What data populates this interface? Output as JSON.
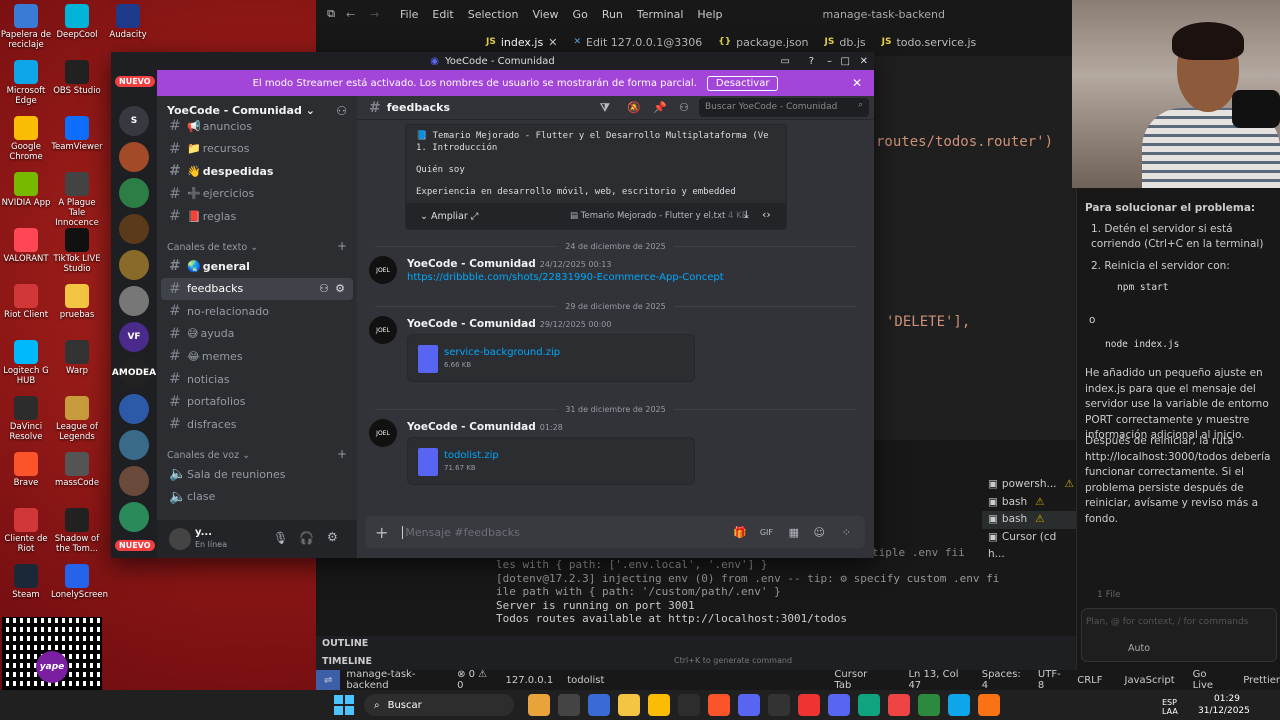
{
  "desktop": {
    "icons": [
      {
        "label": "Papelera de reciclaje",
        "icon": "recycle-bin-icon"
      },
      {
        "label": "DeepCool",
        "icon": "deepcool-icon"
      },
      {
        "label": "Audacity",
        "icon": "audacity-icon"
      },
      {
        "label": "Microsoft Edge",
        "icon": "edge-icon"
      },
      {
        "label": "OBS Studio",
        "icon": "obs-icon"
      },
      {
        "label": "Google Chrome",
        "icon": "chrome-icon"
      },
      {
        "label": "TeamViewer",
        "icon": "teamviewer-icon"
      },
      {
        "label": "NVIDIA App",
        "icon": "nvidia-icon"
      },
      {
        "label": "A Plague Tale Innocence",
        "icon": "game-icon"
      },
      {
        "label": "VALORANT",
        "icon": "valorant-icon"
      },
      {
        "label": "TikTok LIVE Studio",
        "icon": "tiktok-icon"
      },
      {
        "label": "Riot Client",
        "icon": "riot-icon"
      },
      {
        "label": "pruebas",
        "icon": "folder-icon"
      },
      {
        "label": "Logitech G HUB",
        "icon": "logitech-icon"
      },
      {
        "label": "Warp",
        "icon": "warp-icon"
      },
      {
        "label": "DaVinci Resolve",
        "icon": "davinci-icon"
      },
      {
        "label": "League of Legends",
        "icon": "lol-icon"
      },
      {
        "label": "Brave",
        "icon": "brave-icon"
      },
      {
        "label": "massCode",
        "icon": "masscode-icon"
      },
      {
        "label": "Cliente de Riot",
        "icon": "riot-icon"
      },
      {
        "label": "Shadow of the Tom...",
        "icon": "game-icon"
      },
      {
        "label": "Steam",
        "icon": "steam-icon"
      },
      {
        "label": "LonelyScreen",
        "icon": "lonelyscreen-icon"
      }
    ],
    "qr_label": "yape"
  },
  "vscode": {
    "menu": [
      "File",
      "Edit",
      "Selection",
      "View",
      "Go",
      "Run",
      "Terminal",
      "Help"
    ],
    "window_title": "manage-task-backend",
    "tabs": [
      "index.js",
      "Edit 127.0.0.1@3306",
      "package.json",
      "db.js",
      "todo.service.js"
    ],
    "editor_lines": [
      "routes/todos.router')",
      "'DELETE'],"
    ],
    "terminal_lines": [
      "les with { path: ['.env.local', '.env'] }",
      "[dotenv@17.2.3] injecting env (0) from .env -- tip: ⚙ specify custom .env fi",
      "ile path with { path: '/custom/path/.env' }",
      "Server is running on port 3001",
      "Todos routes available at http://localhost:3001/todos"
    ],
    "terminal_partial": "tiple .env fii",
    "terminal_sessions": [
      "powersh...",
      "bash",
      "bash",
      "Cursor (cd h..."
    ],
    "outline": "OUTLINE",
    "timeline": "TIMELINE",
    "generate_hint": "Ctrl+K to generate command",
    "status": {
      "branch": "manage-task-backend",
      "errors": "0",
      "warnings": "0",
      "host": "127.0.0.1",
      "db": "todolist",
      "cursor_tab": "Cursor Tab",
      "position": "Ln 13, Col 47",
      "spaces": "Spaces: 4",
      "encoding": "UTF-8",
      "eol": "CRLF",
      "language": "JavaScript",
      "golive": "Go Live",
      "prettier": "Prettier"
    },
    "chat": {
      "heading": "Para solucionar el problema:",
      "step1": "Detén el servidor si está corriendo (Ctrl+C en la terminal)",
      "step2": "Reinicia el servidor con:",
      "cmd1": "npm start",
      "or": "o",
      "cmd2": "node index.js",
      "para1": "He añadido un pequeño ajuste en index.js para que el mensaje del servidor use la variable de entorno PORT correctamente y muestre información adicional al inicio.",
      "para2": "Después de reiniciar, la ruta http://localhost:3000/todos debería funcionar correctamente. Si el problema persiste después de reiniciar, avísame y reviso más a fondo.",
      "files": "1 File",
      "input_placeholder": "Plan, @ for context, / for commands",
      "mode": "Auto"
    }
  },
  "discord": {
    "title": "YoeCode - Comunidad",
    "streamer_banner": "El modo Streamer está activado. Los nombres de usuario se mostrarán de forma parcial.",
    "deactivate_label": "Desactivar",
    "server_name": "YoeCode - Comunidad",
    "new_badge": "NUEVO",
    "servers": [
      {
        "label": "S",
        "badge": ""
      },
      {
        "label": "",
        "badge": ""
      },
      {
        "label": "",
        "badge": ""
      },
      {
        "label": "",
        "badge": "4"
      },
      {
        "label": "",
        "badge": "22"
      },
      {
        "label": "",
        "badge": ""
      },
      {
        "label": "VF",
        "badge": "22"
      },
      {
        "label": "AMODEA",
        "badge": ""
      },
      {
        "label": "",
        "badge": ""
      },
      {
        "label": "",
        "badge": "14"
      },
      {
        "label": "",
        "badge": ""
      },
      {
        "label": "",
        "badge": "274"
      }
    ],
    "channels_top": [
      {
        "name": "anuncios",
        "emoji": "📢"
      },
      {
        "name": "recursos",
        "emoji": "📁"
      },
      {
        "name": "despedidas",
        "emoji": "👋"
      },
      {
        "name": "ejercicios",
        "emoji": "➕"
      },
      {
        "name": "reglas",
        "emoji": "📕"
      }
    ],
    "text_category": "Canales de texto",
    "text_channels": [
      {
        "name": "general",
        "emoji": "🌏"
      },
      {
        "name": "feedbacks",
        "emoji": ""
      },
      {
        "name": "no-relacionado",
        "emoji": ""
      },
      {
        "name": "ayuda",
        "emoji": "😅"
      },
      {
        "name": "memes",
        "emoji": "😂"
      },
      {
        "name": "noticias",
        "emoji": ""
      },
      {
        "name": "portafolios",
        "emoji": ""
      },
      {
        "name": "disfraces",
        "emoji": ""
      }
    ],
    "voice_category": "Canales de voz",
    "voice_channels": [
      "Sala de reuniones",
      "clase"
    ],
    "user": {
      "name": "y...",
      "status": "En línea"
    },
    "channel_header": "feedbacks",
    "search_placeholder": "Buscar YoeCode - Comunidad",
    "preview": {
      "line1": "📘 Temario Mejorado - Flutter y el Desarrollo Multiplataforma (Ve",
      "line2": "1. Introducción",
      "line3": "Quién soy",
      "line4": "Experiencia en desarrollo móvil, web, escritorio y embedded",
      "expand": "Ampliar",
      "file": "Temario Mejorado - Flutter y el.txt",
      "file_size": "4 KB"
    },
    "messages": [
      {
        "date": "24 de diciembre de 2025",
        "author": "YoeCode - Comunidad",
        "time": "24/12/2025 00:13",
        "link": "https://dribbble.com/shots/22831990-Ecommerce-App-Concept"
      },
      {
        "date": "29 de diciembre de 2025",
        "author": "YoeCode - Comunidad",
        "time": "29/12/2025 00:00",
        "file": "service-background.zip",
        "size": "6.66 KB"
      },
      {
        "date": "31 de diciembre de 2025",
        "author": "YoeCode - Comunidad",
        "time": "01:28",
        "file": "todolist.zip",
        "size": "71.67 KB"
      }
    ],
    "avatar_label": "JOEL",
    "input_placeholder": "Mensaje #feedbacks"
  },
  "taskbar": {
    "search": "Buscar",
    "lang": "ESP",
    "lang_sub": "LAA",
    "time": "01:29",
    "date": "31/12/2025"
  }
}
